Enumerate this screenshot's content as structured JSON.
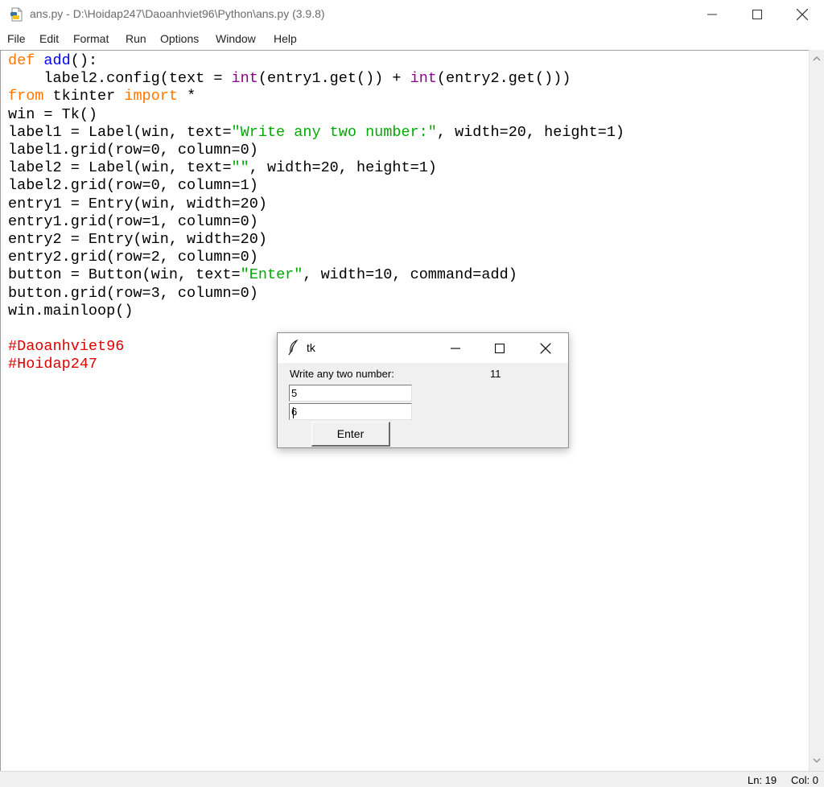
{
  "window": {
    "title": "ans.py - D:\\Hoidap247\\Daoanhviet96\\Python\\ans.py (3.9.8)"
  },
  "menu": [
    "File",
    "Edit",
    "Format",
    "Run",
    "Options",
    "Window",
    "Help"
  ],
  "editor": {
    "lines": [
      [
        {
          "t": "def",
          "c": "kw"
        },
        {
          "t": " "
        },
        {
          "t": "add",
          "c": "def"
        },
        {
          "t": "():"
        }
      ],
      [
        {
          "t": "    label2.config(text = "
        },
        {
          "t": "int",
          "c": "bi"
        },
        {
          "t": "(entry1.get()) + "
        },
        {
          "t": "int",
          "c": "bi"
        },
        {
          "t": "(entry2.get()))"
        }
      ],
      [
        {
          "t": "from",
          "c": "kw"
        },
        {
          "t": " tkinter "
        },
        {
          "t": "import",
          "c": "kw"
        },
        {
          "t": " *"
        }
      ],
      [
        {
          "t": "win = Tk()"
        }
      ],
      [
        {
          "t": "label1 = Label(win, text="
        },
        {
          "t": "\"Write any two number:\"",
          "c": "str"
        },
        {
          "t": ", width=20, height=1)"
        }
      ],
      [
        {
          "t": "label1.grid(row=0, column=0)"
        }
      ],
      [
        {
          "t": "label2 = Label(win, text="
        },
        {
          "t": "\"\"",
          "c": "str"
        },
        {
          "t": ", width=20, height=1)"
        }
      ],
      [
        {
          "t": "label2.grid(row=0, column=1)"
        }
      ],
      [
        {
          "t": "entry1 = Entry(win, width=20)"
        }
      ],
      [
        {
          "t": "entry1.grid(row=1, column=0)"
        }
      ],
      [
        {
          "t": "entry2 = Entry(win, width=20)"
        }
      ],
      [
        {
          "t": "entry2.grid(row=2, column=0)"
        }
      ],
      [
        {
          "t": "button = Button(win, text="
        },
        {
          "t": "\"Enter\"",
          "c": "str"
        },
        {
          "t": ", width=10, command=add)"
        }
      ],
      [
        {
          "t": "button.grid(row=3, column=0)"
        }
      ],
      [
        {
          "t": "win.mainloop()"
        }
      ],
      [],
      [
        {
          "t": "#Daoanhviet96",
          "c": "cm"
        }
      ],
      [
        {
          "t": "#Hoidap247",
          "c": "cm"
        }
      ]
    ]
  },
  "status": {
    "ln": "Ln: 19",
    "col": "Col: 0"
  },
  "tk_window": {
    "title": "tk",
    "label1": "Write any two number:",
    "label2": "11",
    "entry1": "5",
    "entry2": "6",
    "button": "Enter"
  },
  "colors": {
    "keyword": "#ff7700",
    "builtin": "#900090",
    "definition": "#0000ff",
    "string": "#00aa00",
    "comment": "#dd0000"
  },
  "icons": [
    "python-file-icon",
    "minimize-icon",
    "maximize-icon",
    "close-icon",
    "tk-feather-icon",
    "scroll-up-icon",
    "scroll-down-icon"
  ]
}
